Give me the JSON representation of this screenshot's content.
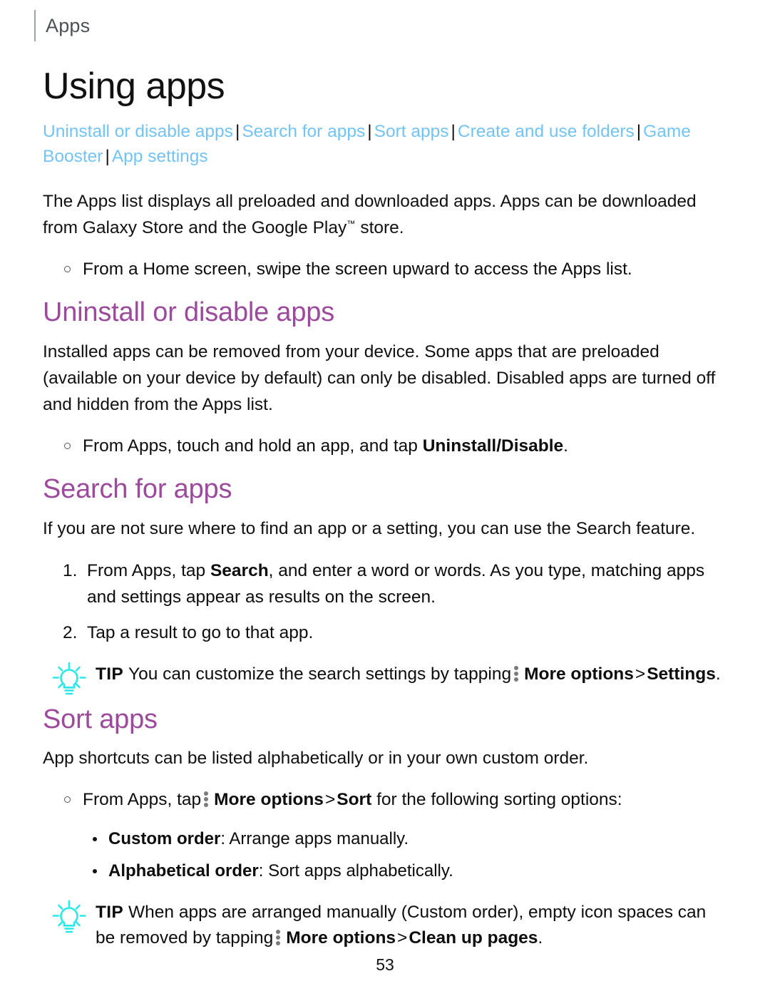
{
  "header": {
    "label": "Apps"
  },
  "title": "Using apps",
  "jumplinks": {
    "separator": "|",
    "items": [
      "Uninstall or disable apps",
      "Search for apps",
      "Sort apps",
      "Create and use folders",
      "Game Booster",
      "App settings"
    ]
  },
  "intro": {
    "paragraph_before_tm": "The Apps list displays all preloaded and downloaded apps. Apps can be downloaded from Galaxy Store and the Google Play",
    "tm": "™",
    "paragraph_after_tm": "store.",
    "bullets": [
      "From a Home screen, swipe the screen upward to access the Apps list."
    ]
  },
  "sections": [
    {
      "heading": "Uninstall or disable apps",
      "paragraph": "Installed apps can be removed from your device. Some apps that are preloaded (available on your device by default) can only be disabled. Disabled apps are turned off and hidden from the Apps list.",
      "bullet_lead": "From Apps, touch and hold an app, and tap",
      "bullet_bold": "Uninstall/Disable",
      "bullet_tail": "."
    },
    {
      "heading": "Search for apps",
      "paragraph": "If you are not sure where to find an app or a setting, you can use the Search feature.",
      "steps": [
        {
          "number": "1.",
          "lead": "From Apps, tap",
          "bold": "Search",
          "tail": ", and enter a word or words. As you type, matching apps and settings appear as results on the screen."
        },
        {
          "number": "2.",
          "lead": "Tap a result to go to that app.",
          "bold": "",
          "tail": ""
        }
      ]
    },
    {
      "heading": "Sort apps",
      "paragraph": "App shortcuts can be listed alphabetically or in your own custom order.",
      "bullet_lead": "From Apps, tap",
      "bullet_bold_1": "More options",
      "bullet_gt": ">",
      "bullet_bold_2": "Sort",
      "bullet_tail": "for the following sorting options:",
      "options": [
        {
          "term": "Custom order",
          "colon": ":",
          "definition": "Arrange apps manually."
        },
        {
          "term": "Alphabetical order",
          "colon": ":",
          "definition": "Sort apps alphabetically."
        }
      ]
    }
  ],
  "tips": [
    {
      "word": "TIP",
      "lead": "You can customize the search settings by tapping",
      "bold_1": "More options",
      "gt": ">",
      "bold_2": "Settings",
      "tail": "."
    },
    {
      "word": "TIP",
      "lead": "When apps are arranged manually (Custom order), empty icon spaces can be removed by tapping",
      "bold_1": "More options",
      "gt": ">",
      "bold_2": "Clean up pages",
      "tail": "."
    }
  ],
  "footer": {
    "page_number": "53"
  },
  "colors": {
    "link": "#73c4f4",
    "section_heading": "#9c4a9c",
    "tip_icon": "#2ae8ea",
    "header_text": "#4b5356",
    "header_rule": "#9aa3a6",
    "body_text": "#111111",
    "kebab_dot": "#7a7a7a"
  }
}
